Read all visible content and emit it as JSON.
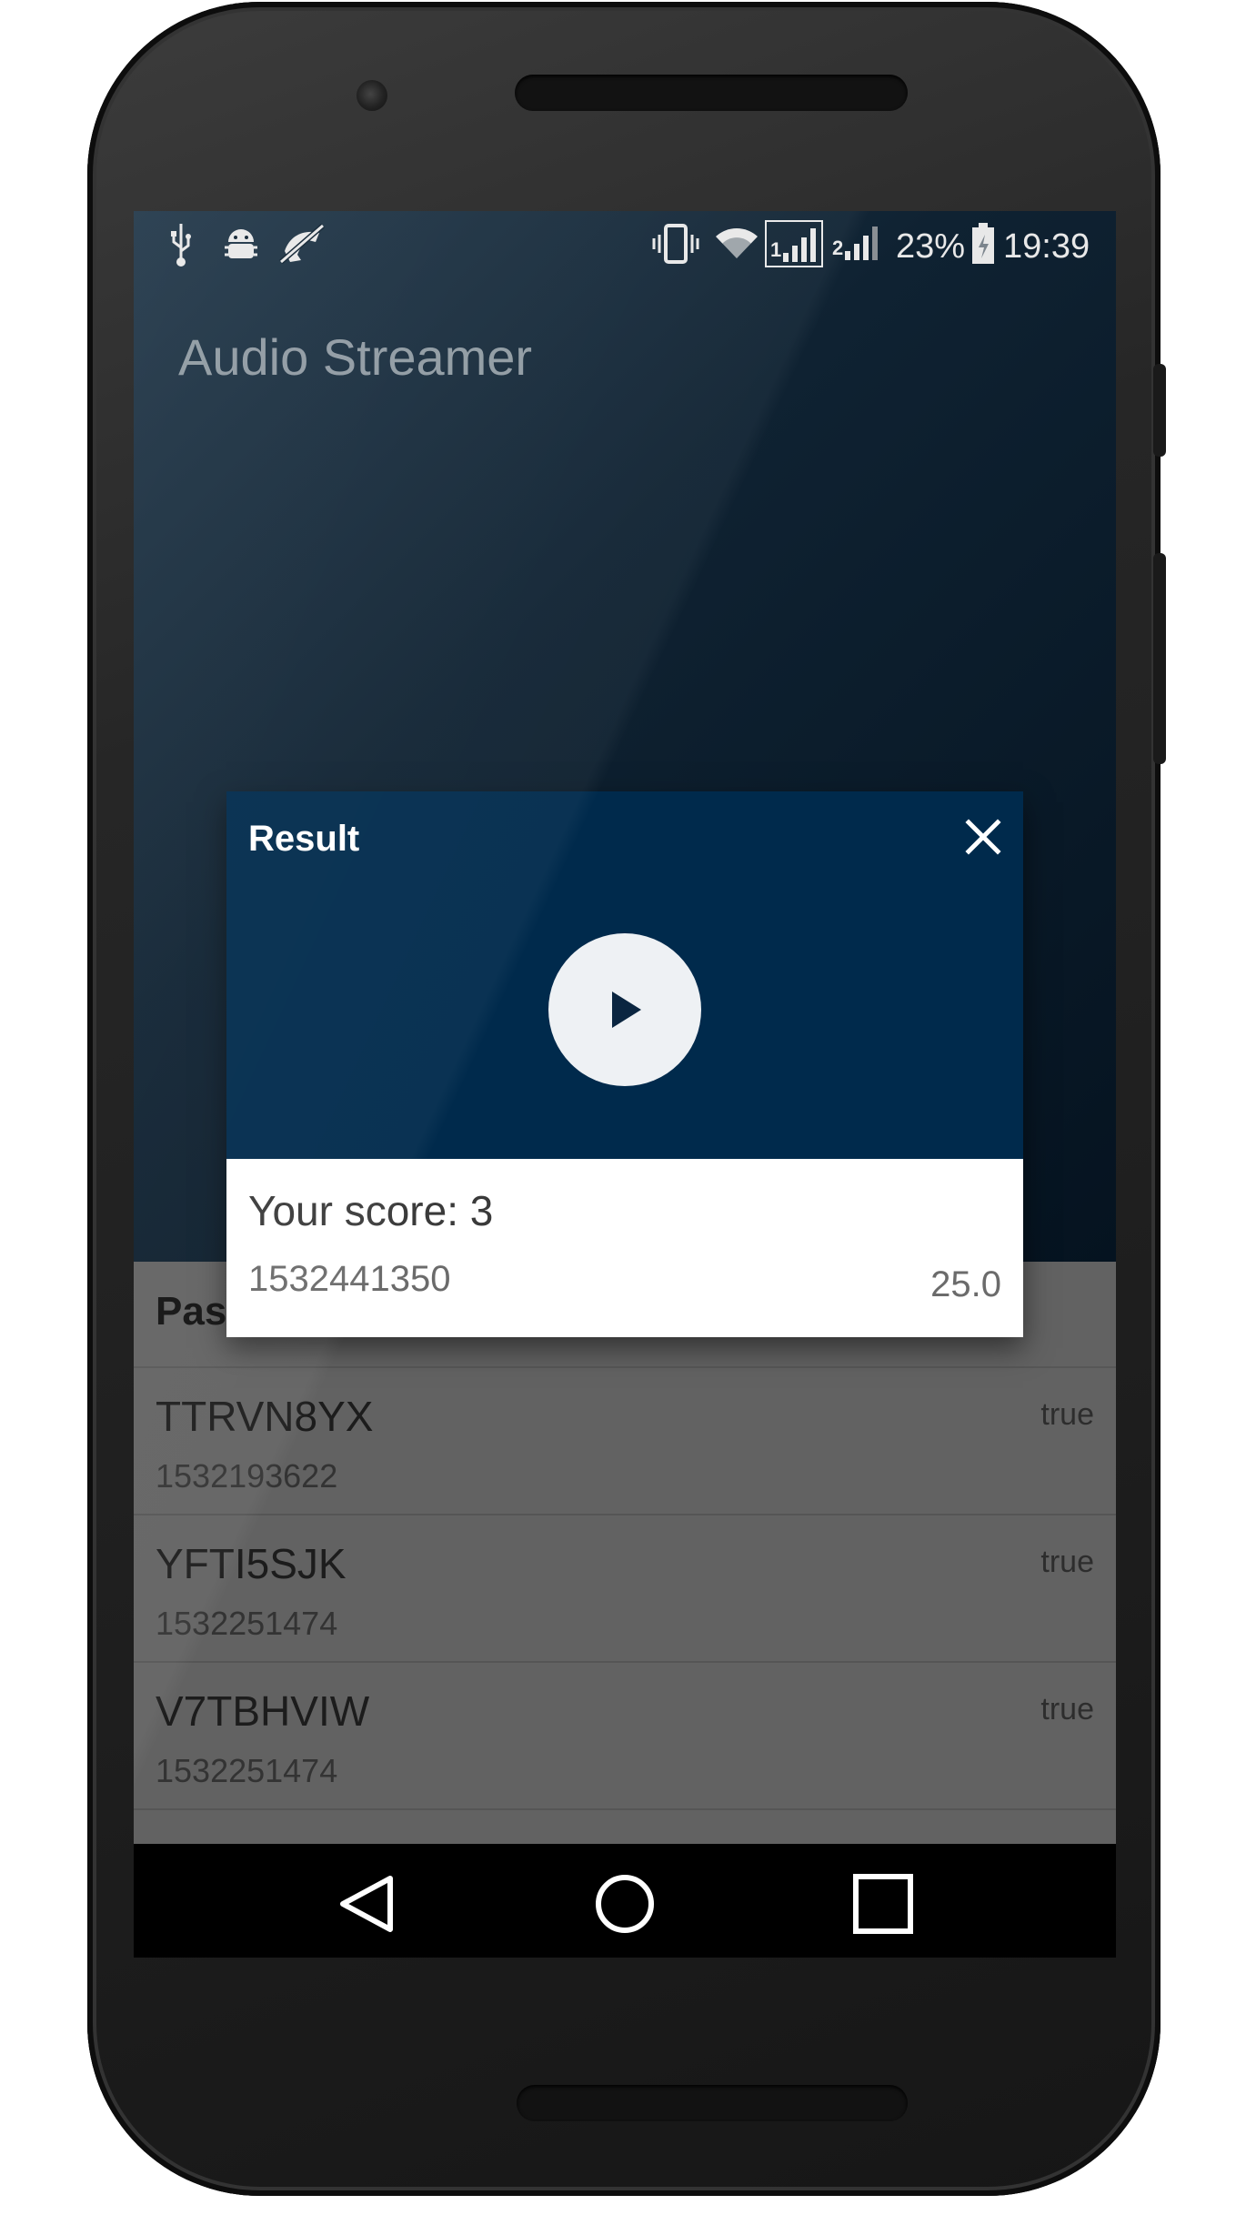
{
  "status_bar": {
    "battery": "23%",
    "time": "19:39",
    "left_icons": [
      "usb-icon",
      "android-debug-icon",
      "no-phone-icon"
    ],
    "right_icons": [
      "vibrate-icon",
      "wifi-icon",
      "signal-sim1-icon",
      "signal-sim2-icon",
      "battery-icon"
    ],
    "sim1_label": "1",
    "sim2_label": "2"
  },
  "app": {
    "title": "Audio Streamer"
  },
  "list": {
    "header": "Pas",
    "items": [
      {
        "title": "TTRVN8YX",
        "subtitle": "1532193622",
        "status": "true"
      },
      {
        "title": "YFTI5SJK",
        "subtitle": "1532251474",
        "status": "true"
      },
      {
        "title": "V7TBHVIW",
        "subtitle": "1532251474",
        "status": "true"
      }
    ]
  },
  "dialog": {
    "title": "Result",
    "close_icon": "close-icon",
    "play_icon": "play-icon",
    "score": "Your score: 3",
    "timestamp": "1532441350",
    "value": "25.0"
  },
  "nav": {
    "icons": [
      "back-icon",
      "home-icon",
      "recents-icon"
    ]
  },
  "colors": {
    "dialog_header": "#002a4c",
    "list_background": "#626262",
    "nav_bar": "#000000"
  }
}
